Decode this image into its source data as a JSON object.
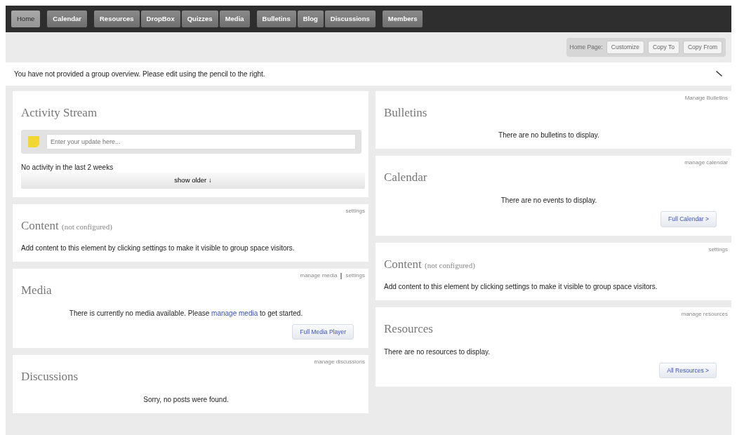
{
  "nav": [
    [
      {
        "label": "Home",
        "selected": true
      }
    ],
    [
      {
        "label": "Calendar",
        "selected": false
      }
    ],
    [
      {
        "label": "Resources",
        "selected": false
      },
      {
        "label": "DropBox",
        "selected": false
      },
      {
        "label": "Quizzes",
        "selected": false
      },
      {
        "label": "Media",
        "selected": false
      }
    ],
    [
      {
        "label": "Bulletins",
        "selected": false
      },
      {
        "label": "Blog",
        "selected": false
      },
      {
        "label": "Discussions",
        "selected": false
      }
    ],
    [
      {
        "label": "Members",
        "selected": false
      }
    ]
  ],
  "page_toolbar": {
    "label": "Home Page:",
    "buttons": [
      "Customize",
      "Copy To",
      "Copy From"
    ]
  },
  "overview": {
    "text": "You have not provided a group overview. Please edit using the pencil to the right."
  },
  "columns": [
    [
      {
        "kind": "activity",
        "title": "Activity Stream",
        "placeholder": "Enter your update here...",
        "status": "No activity in the last 2 weeks",
        "more": "show older ↓"
      },
      {
        "kind": "text",
        "title": "Content",
        "title_note": "(not configured)",
        "links": [
          "settings"
        ],
        "centered": false,
        "message": [
          {
            "kind": "plain",
            "text": "Add content to this element by clicking settings to make it visible to group space visitors."
          }
        ]
      },
      {
        "kind": "text",
        "title": "Media",
        "links": [
          "manage media",
          "settings"
        ],
        "centered": true,
        "message": [
          {
            "kind": "plain",
            "text": "There is currently no media available. Please "
          },
          {
            "kind": "link",
            "text": "manage media"
          },
          {
            "kind": "plain",
            "text": " to get started."
          }
        ],
        "button": "Full Media Player"
      },
      {
        "kind": "text",
        "title": "Discussions",
        "links": [
          "manage discussions"
        ],
        "centered": true,
        "message": [
          {
            "kind": "plain",
            "text": "Sorry, no posts were found."
          }
        ]
      }
    ],
    [
      {
        "kind": "text",
        "title": "Bulletins",
        "links": [
          "Manage Bulletins"
        ],
        "centered": true,
        "message": [
          {
            "kind": "plain",
            "text": "There are no bulletins to display."
          }
        ]
      },
      {
        "kind": "text",
        "title": "Calendar",
        "links": [
          "manage calendar"
        ],
        "centered": true,
        "message": [
          {
            "kind": "plain",
            "text": "There are no events to display."
          }
        ],
        "button": "Full Calendar >"
      },
      {
        "kind": "text",
        "title": "Content",
        "title_note": "(not configured)",
        "links": [
          "settings"
        ],
        "centered": false,
        "message": [
          {
            "kind": "plain",
            "text": "Add content to this element by clicking settings to make it visible to group space visitors."
          }
        ]
      },
      {
        "kind": "text",
        "title": "Resources",
        "links": [
          "manage resources"
        ],
        "centered": false,
        "message": [
          {
            "kind": "plain",
            "text": "There are no resources to display."
          }
        ],
        "button": "All Resources >"
      }
    ]
  ]
}
